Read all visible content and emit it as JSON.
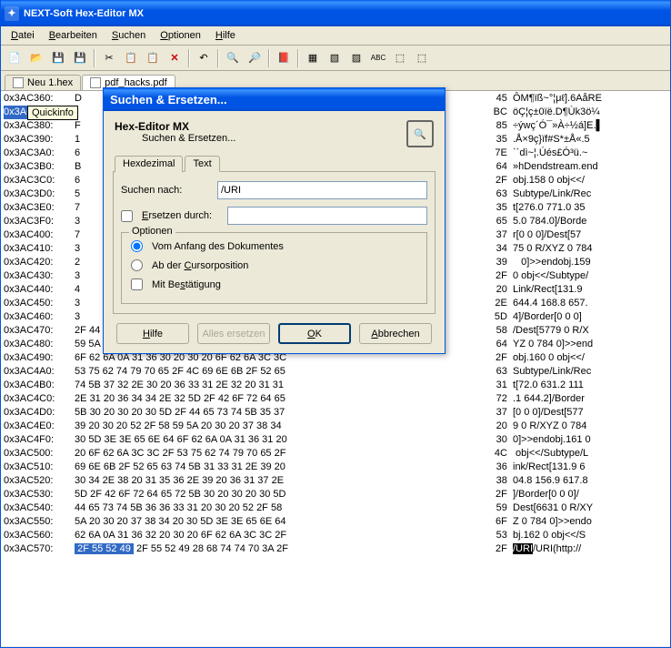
{
  "window": {
    "title": "NEXT-Soft Hex-Editor MX"
  },
  "menu": {
    "file": "Datei",
    "edit": "Bearbeiten",
    "search": "Suchen",
    "options": "Optionen",
    "help": "Hilfe"
  },
  "tabs": {
    "t1": "Neu 1.hex",
    "t2": "pdf_hacks.pdf"
  },
  "tooltip": "Quickinfo",
  "dialog": {
    "title": "Suchen & Ersetzen...",
    "head_title": "Hex-Editor MX",
    "head_sub": "Suchen & Ersetzen...",
    "tab_hex": "Hexdezimal",
    "tab_text": "Text",
    "search_label": "Suchen nach:",
    "search_value": "/URI",
    "replace_label": "Ersetzen durch:",
    "replace_value": "",
    "options_legend": "Optionen",
    "opt_from_start": "Vom Anfang des Dokumentes",
    "opt_from_cursor": "Ab der Cursorposition",
    "opt_confirm": "Mit Bestätigung",
    "btn_help": "Hilfe",
    "btn_replace_all": "Alles ersetzen",
    "btn_ok": "OK",
    "btn_cancel": "Abbrechen"
  },
  "hex": {
    "rows": [
      {
        "a": "0x3AC360:",
        "b": " D",
        "c": "45",
        "t": "ÔM¶ïß~°¦μℓ].6AåRE"
      },
      {
        "a": "0x3AC370:",
        "b": "",
        "c": "BC",
        "t": "öÇ¦ç±0ïë.D¶Ùk3ö¼"
      },
      {
        "a": "0x3AC380:",
        "b": " F",
        "c": "85",
        "t": "÷ýwç´Ó¯»À÷½á]E.▌"
      },
      {
        "a": "0x3AC390:",
        "b": " 1",
        "c": "35",
        "t": ".Å×9ç}ïf#S*±Å«.5"
      },
      {
        "a": "0x3AC3A0:",
        "b": " 6",
        "c": "7E",
        "t": "``dì~¦.Úés£Ó³ü.~"
      },
      {
        "a": "0x3AC3B0:",
        "b": " B",
        "c": "64",
        "t": "»hDendstream.end"
      },
      {
        "a": "0x3AC3C0:",
        "b": " 6",
        "c": "2F",
        "t": "obj.158 0 obj<</"
      },
      {
        "a": "0x3AC3D0:",
        "b": " 5",
        "c": "63",
        "t": "Subtype/Link/Rec"
      },
      {
        "a": "0x3AC3E0:",
        "b": " 7",
        "c": "35",
        "t": "t[276.0 771.0 35"
      },
      {
        "a": "0x3AC3F0:",
        "b": " 3",
        "c": "65",
        "t": "5.0 784.0]/Borde"
      },
      {
        "a": "0x3AC400:",
        "b": " 7",
        "c": "37",
        "t": "r[0 0 0]/Dest[57"
      },
      {
        "a": "0x3AC410:",
        "b": " 3",
        "c": "34",
        "t": "75 0 R/XYZ 0 784"
      },
      {
        "a": "0x3AC420:",
        "b": " 2",
        "c": "39",
        "t": "   0]>>endobj.159"
      },
      {
        "a": "0x3AC430:",
        "b": " 3",
        "c": "2F",
        "t": "0 obj<</Subtype/"
      },
      {
        "a": "0x3AC440:",
        "b": " 4",
        "c": "20",
        "t": "Link/Rect[131.9 "
      },
      {
        "a": "0x3AC450:",
        "b": " 3",
        "c": "2E",
        "t": "644.4 168.8 657."
      },
      {
        "a": "0x3AC460:",
        "b": " 3",
        "c": "5D",
        "t": "4]/Border[0 0 0]"
      },
      {
        "a": "0x3AC470:",
        "b": " 2F 44 65 73 74 5B 35 37 37 39 20 30 20 52 2F",
        "c": "58",
        "t": "/Dest[5779 0 R/X"
      },
      {
        "a": "0x3AC480:",
        "b": " 59 5A 20 30 20 37 38 34 20 30 5D 3E 3E 65 6E",
        "c": "64",
        "t": "YZ 0 784 0]>>end"
      },
      {
        "a": "0x3AC490:",
        "b": " 6F 62 6A 0A 31 36 30 20 30 20 6F 62 6A 3C 3C",
        "c": "2F",
        "t": "obj.160 0 obj<</"
      },
      {
        "a": "0x3AC4A0:",
        "b": " 53 75 62 74 79 70 65 2F 4C 69 6E 6B 2F 52 65",
        "c": "63",
        "t": "Subtype/Link/Rec"
      },
      {
        "a": "0x3AC4B0:",
        "b": " 74 5B 37 32 2E 30 20 36 33 31 2E 32 20 31 31",
        "c": "31",
        "t": "t[72.0 631.2 111"
      },
      {
        "a": "0x3AC4C0:",
        "b": " 2E 31 20 36 34 34 2E 32 5D 2F 42 6F 72 64 65",
        "c": "72",
        "t": ".1 644.2]/Border"
      },
      {
        "a": "0x3AC4D0:",
        "b": " 5B 30 20 30 20 30 5D 2F 44 65 73 74 5B 35 37",
        "c": "37",
        "t": "[0 0 0]/Dest[577"
      },
      {
        "a": "0x3AC4E0:",
        "b": " 39 20 30 20 52 2F 58 59 5A 20 30 20 37 38 34",
        "c": "20",
        "t": "9 0 R/XYZ 0 784 "
      },
      {
        "a": "0x3AC4F0:",
        "b": " 30 5D 3E 3E 65 6E 64 6F 62 6A 0A 31 36 31 20",
        "c": "30",
        "t": "0]>>endobj.161 0"
      },
      {
        "a": "0x3AC500:",
        "b": " 20 6F 62 6A 3C 3C 2F 53 75 62 74 79 70 65 2F",
        "c": "4C",
        "t": " obj<</Subtype/L"
      },
      {
        "a": "0x3AC510:",
        "b": " 69 6E 6B 2F 52 65 63 74 5B 31 33 31 2E 39 20",
        "c": "36",
        "t": "ink/Rect[131.9 6"
      },
      {
        "a": "0x3AC520:",
        "b": " 30 34 2E 38 20 31 35 36 2E 39 20 36 31 37 2E",
        "c": "38",
        "t": "04.8 156.9 617.8"
      },
      {
        "a": "0x3AC530:",
        "b": " 5D 2F 42 6F 72 64 65 72 5B 30 20 30 20 30 5D",
        "c": "2F",
        "t": "]/Border[0 0 0]/"
      },
      {
        "a": "0x3AC540:",
        "b": " 44 65 73 74 5B 36 36 33 31 20 30 20 52 2F 58",
        "c": "59",
        "t": "Dest[6631 0 R/XY"
      },
      {
        "a": "0x3AC550:",
        "b": " 5A 20 30 20 37 38 34 20 30 5D 3E 3E 65 6E 64",
        "c": "6F",
        "t": "Z 0 784 0]>>endo"
      },
      {
        "a": "0x3AC560:",
        "b": " 62 6A 0A 31 36 32 20 30 20 6F 62 6A 3C 3C 2F",
        "c": "53",
        "t": "bj.162 0 obj<</S"
      },
      {
        "a": "0x3AC570:",
        "b": "",
        "sel": "2F 55 52 49",
        "b2": "2F 55 52 49 28 68 74 74 70 3A 2F",
        "c": "2F",
        "tsel": "/URI",
        "t": "/URI(http://"
      }
    ]
  },
  "chart_data": null
}
